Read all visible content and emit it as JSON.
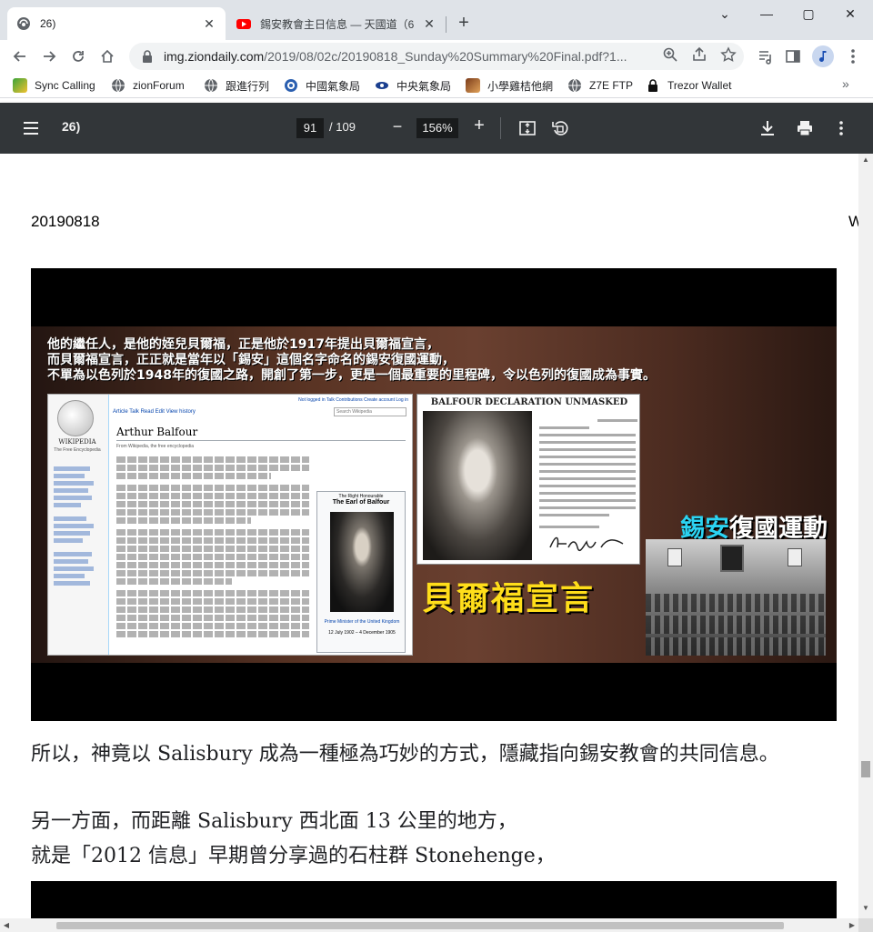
{
  "browser": {
    "tabs": [
      {
        "title": "26)",
        "active": true
      },
      {
        "title": "錫安教會主日信息 — 天國道（6",
        "active": false
      }
    ],
    "window_controls": {
      "minimize": "—",
      "maximize": "▢",
      "close": "✕"
    },
    "url_host": "img.ziondaily.com",
    "url_path": "/2019/08/02c/20190818_Sunday%20Summary%20Final.pdf?1..."
  },
  "bookmarks": [
    {
      "label": "Sync Calling",
      "icon": "sync-calling-icon"
    },
    {
      "label": "zionForum",
      "icon": "globe-icon"
    },
    {
      "label": "跟進行列",
      "icon": "globe-icon"
    },
    {
      "label": "中國氣象局",
      "icon": "weather-icon"
    },
    {
      "label": "中央氣象局",
      "icon": "eye-icon"
    },
    {
      "label": "小學雞桔他網",
      "icon": "guitar-icon"
    },
    {
      "label": "Z7E FTP",
      "icon": "globe-icon"
    },
    {
      "label": "Trezor Wallet",
      "icon": "lock-icon"
    }
  ],
  "pdf": {
    "title": "26)",
    "current_page": "91",
    "total_pages": "109",
    "zoom": "156%"
  },
  "content": {
    "date": "20190818",
    "edge_letter": "W",
    "video": {
      "caption_line1": "他的繼任人，是他的姪兒貝爾福，正是他於1917年提出貝爾福宣言，",
      "caption_line2": "而貝爾福宣言，正正就是當年以「錫安」這個名字命名的錫安復國運動，",
      "caption_line3": "不單為以色列於1948年的復國之路，開創了第一步，更是一個最重要的里程碑，令以色列的復國成為事實。",
      "wiki_brand": "WIKIPEDIA",
      "wiki_tagline": "The Free Encyclopedia",
      "wiki_article_title": "Arthur Balfour",
      "wiki_from": "From Wikipedia, the free encyclopedia",
      "wiki_tabs": "Article   Talk          Read   Edit   View history",
      "wiki_search": "Search Wikipedia",
      "wiki_top": "Not logged in  Talk  Contributions  Create account  Log in",
      "infobox_honorific": "The Right Honourable",
      "infobox_name": "The Earl of Balfour",
      "infobox_office": "Prime Minister of the United Kingdom",
      "infobox_term": "12 July 1902 – 4 December 1905",
      "declaration_title": "BALFOUR DECLARATION UNMASKED",
      "balfour_title": "貝爾福宣言",
      "zion_highlight": "錫安",
      "zion_rest": "復國運動"
    },
    "paragraph1": "所以，神竟以 Salisbury 成為一種極為巧妙的方式，隱藏指向錫安教會的共同信息。",
    "paragraph2_line1": "另一方面，而距離 Salisbury 西北面 13 公里的地方，",
    "paragraph2_line2": "就是「2012 信息」早期曾分享過的石柱群 Stonehenge，"
  }
}
